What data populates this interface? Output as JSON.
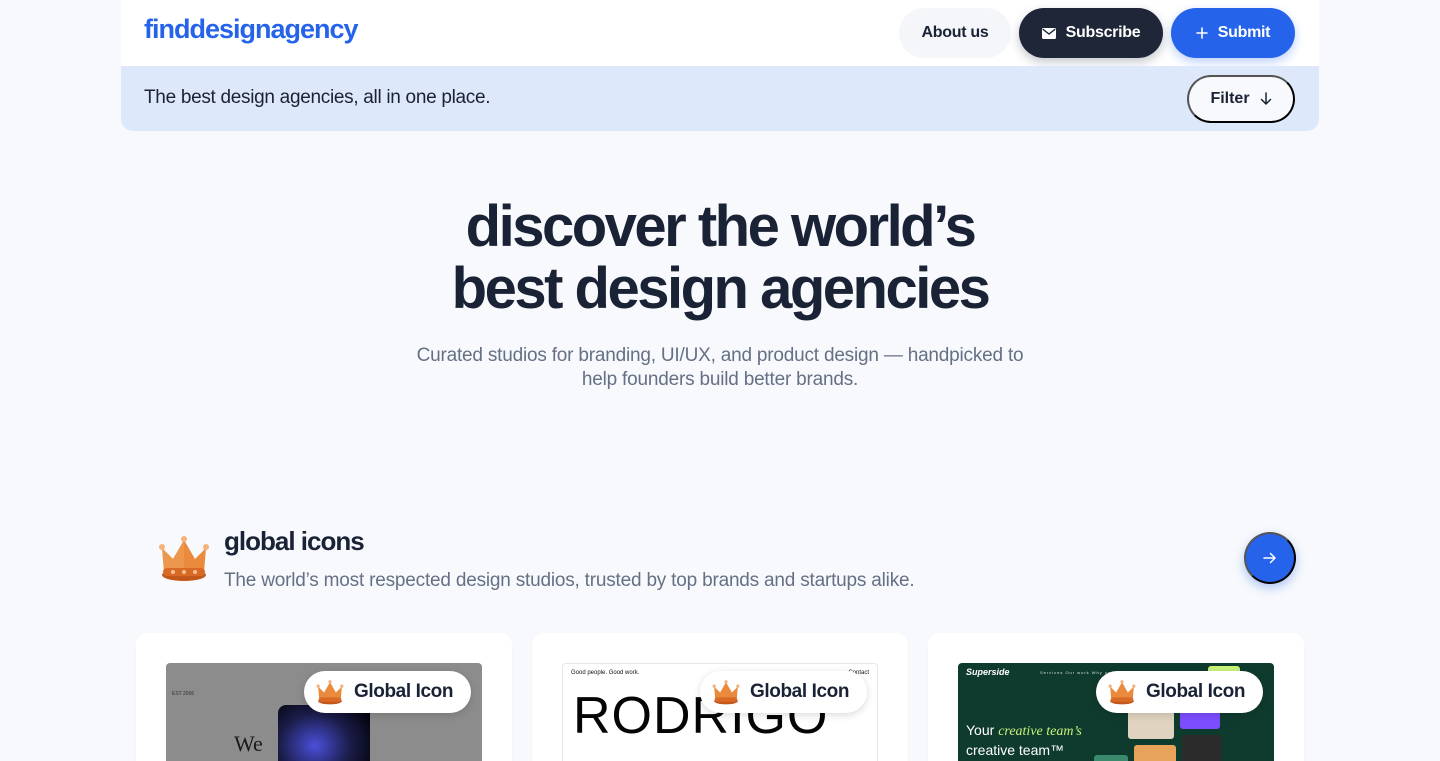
{
  "header": {
    "logo": "finddesignagency",
    "nav": {
      "about_label": "About us",
      "subscribe_label": "Subscribe",
      "submit_label": "Submit"
    }
  },
  "subbar": {
    "tagline": "The best design agencies, all in one place.",
    "filter_label": "Filter"
  },
  "hero": {
    "title_line1": "discover the world’s",
    "title_line2": "best design agencies",
    "subtitle": "Curated studios for branding, UI/UX, and product design — handpicked to help founders build better brands."
  },
  "section": {
    "icon": "crown-icon",
    "title": "global icons",
    "description": "The world’s most respected design studios, trusted by top brands and startups alike."
  },
  "cards": [
    {
      "badge": "Global Icon",
      "thumb_text": {
        "small": "EST 2006",
        "headline": "We"
      }
    },
    {
      "badge": "Global Icon",
      "thumb_text": {
        "small_left": "Good people. Good work.",
        "small_right": "Contact",
        "headline": "RODRIGO"
      }
    },
    {
      "badge": "Global Icon",
      "thumb_text": {
        "brand": "Superside",
        "menu": "Services   Our work   Why us",
        "headline_em": "creative team’s",
        "headline_pre": "Your",
        "headline_post": "creative team™"
      }
    }
  ],
  "colors": {
    "brand_blue": "#2563eb",
    "dark": "#1e2638",
    "subbar_bg": "#dde9fb",
    "page_bg": "#f7f9fc"
  }
}
